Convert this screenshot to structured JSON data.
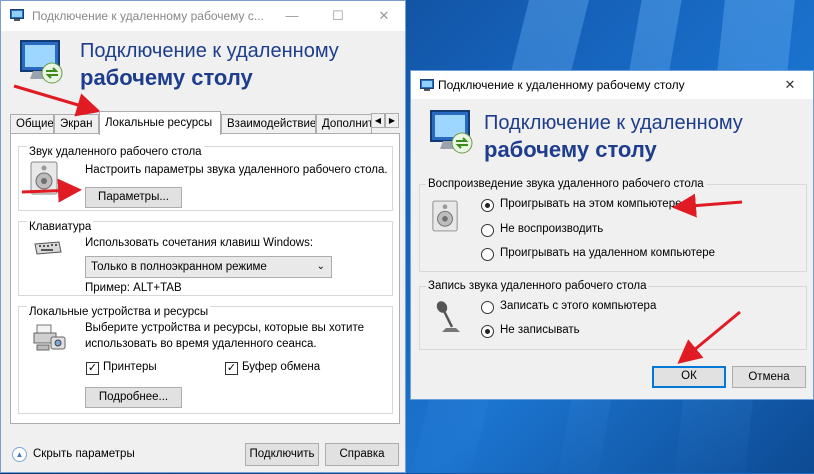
{
  "win1": {
    "title": "Подключение к удаленному рабочему с...",
    "minimize": "—",
    "maximize": "☐",
    "close": "✕",
    "banner_line1": "Подключение к удаленному",
    "banner_line2": "рабочему столу",
    "tabs": [
      "Общие",
      "Экран",
      "Локальные ресурсы",
      "Взаимодействие",
      "Дополнит"
    ],
    "tab_scroll_left": "◀",
    "tab_scroll_right": "▶",
    "sound_group": {
      "title": "Звук удаленного рабочего стола",
      "text": "Настроить параметры звука удаленного рабочего стола.",
      "button": "Параметры..."
    },
    "keyboard_group": {
      "title": "Клавиатура",
      "text": "Использовать сочетания клавиш Windows:",
      "select_value": "Только в полноэкранном режиме",
      "example": "Пример: ALT+TAB"
    },
    "devices_group": {
      "title": "Локальные устройства и ресурсы",
      "text_line1": "Выберите устройства и ресурсы, которые вы хотите",
      "text_line2": "использовать во время удаленного сеанса.",
      "printers_label": "Принтеры",
      "clipboard_label": "Буфер обмена",
      "more_button": "Подробнее..."
    },
    "hide_params": "Скрыть параметры",
    "connect_button": "Подключить",
    "help_button": "Справка"
  },
  "win2": {
    "title": "Подключение к удаленному рабочему столу",
    "close": "✕",
    "banner_line1": "Подключение к удаленному",
    "banner_line2": "рабочему столу",
    "playback_group": {
      "title": "Воспроизведение звука удаленного рабочего стола",
      "options": [
        "Проигрывать на этом компьютере",
        "Не воспроизводить",
        "Проигрывать на удаленном компьютере"
      ],
      "selected_index": 0
    },
    "record_group": {
      "title": "Запись звука удаленного рабочего стола",
      "options": [
        "Записать с этого компьютера",
        "Не записывать"
      ],
      "selected_index": 1
    },
    "ok_button": "ОК",
    "cancel_button": "Отмена"
  },
  "colors": {
    "accent": "#0078d7",
    "banner_text": "#1e3d8c",
    "annotation_arrow": "#e01b24"
  }
}
